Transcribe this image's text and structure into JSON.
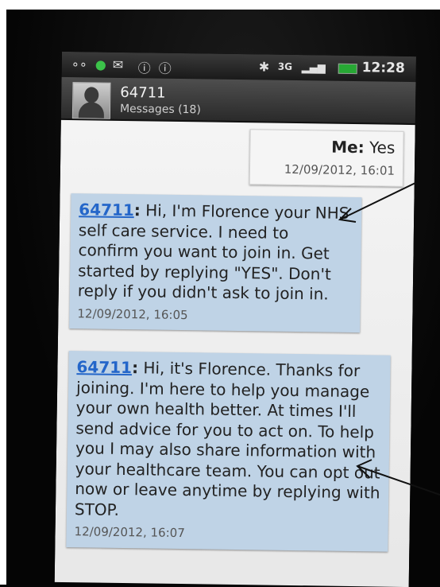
{
  "status_bar": {
    "clock": "12:28",
    "network": "3G",
    "battery_color": "#27a834"
  },
  "header": {
    "contact": "64711",
    "subtitle": "Messages (18)"
  },
  "messages": [
    {
      "sender": "Me",
      "text": "Yes",
      "timestamp": "12/09/2012, 16:01",
      "direction": "sent"
    },
    {
      "sender": "64711",
      "text": "Hi, I'm Florence your NHS self care service. I need to confirm you want to join in. Get started by replying \"YES\". Don't reply if you didn't ask to join in.",
      "timestamp": "12/09/2012, 16:05",
      "direction": "received"
    },
    {
      "sender": "64711",
      "text": "Hi, it's Florence. Thanks for joining. I'm here to help you manage your own health better. At times I'll send advice for you to act on. To help you I may also share information with your healthcare team. You can opt out now or leave anytime by replying with STOP.",
      "timestamp": "12/09/2012, 16:07",
      "direction": "received"
    }
  ],
  "colors": {
    "received_bubble": "#bfd3e6",
    "sender_link": "#2466c9"
  }
}
